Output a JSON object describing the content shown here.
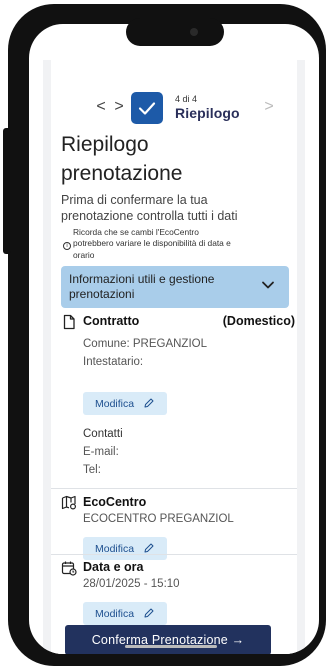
{
  "stepper": {
    "prev_symbol": "<",
    "next_symbol": ">",
    "forward_disabled_symbol": ">",
    "step_count": "4 di 4",
    "step_name": "Riepilogo"
  },
  "page": {
    "title_line1": "Riepilogo",
    "title_line2": "prenotazione",
    "intro_line1": "Prima di confermare la tua",
    "intro_line2": "prenotazione controlla tutti i dati",
    "notice_line1": "Ricorda che se cambi l'EcoCentro",
    "notice_line2": "potrebbero variare le disponibilità di data e",
    "notice_line3": "orario",
    "notice_icon": "i"
  },
  "accordion": {
    "label_line1": "Informazioni utili e gestione",
    "label_line2": "prenotazioni"
  },
  "contratto": {
    "title": "Contratto",
    "type": "(Domestico)",
    "comune": "Comune: PREGANZIOL",
    "intestatario": "Intestatario:",
    "edit_label": "Modifica"
  },
  "contatti": {
    "title": "Contatti",
    "email": "E-mail:",
    "tel": "Tel:"
  },
  "ecocentro": {
    "title": "EcoCentro",
    "value": "ECOCENTRO PREGANZIOL",
    "edit_label": "Modifica"
  },
  "data_ora": {
    "title": "Data e ora",
    "value": "28/01/2025 - 15:10",
    "edit_label": "Modifica"
  },
  "confirm_label": "Conferma Prenotazione  →",
  "icons": {
    "document": "document-icon",
    "map_pin": "map-icon",
    "calendar": "calendar-clock-icon",
    "pencil": "pencil-icon",
    "check": "check-icon",
    "chevron": "chevron-down-icon",
    "info": "info-icon"
  },
  "colors": {
    "primary": "#1d5aa8",
    "confirm_button": "#22325e",
    "accordion_bg": "#a9cdea",
    "edit_button_bg": "#d9ebf8"
  }
}
